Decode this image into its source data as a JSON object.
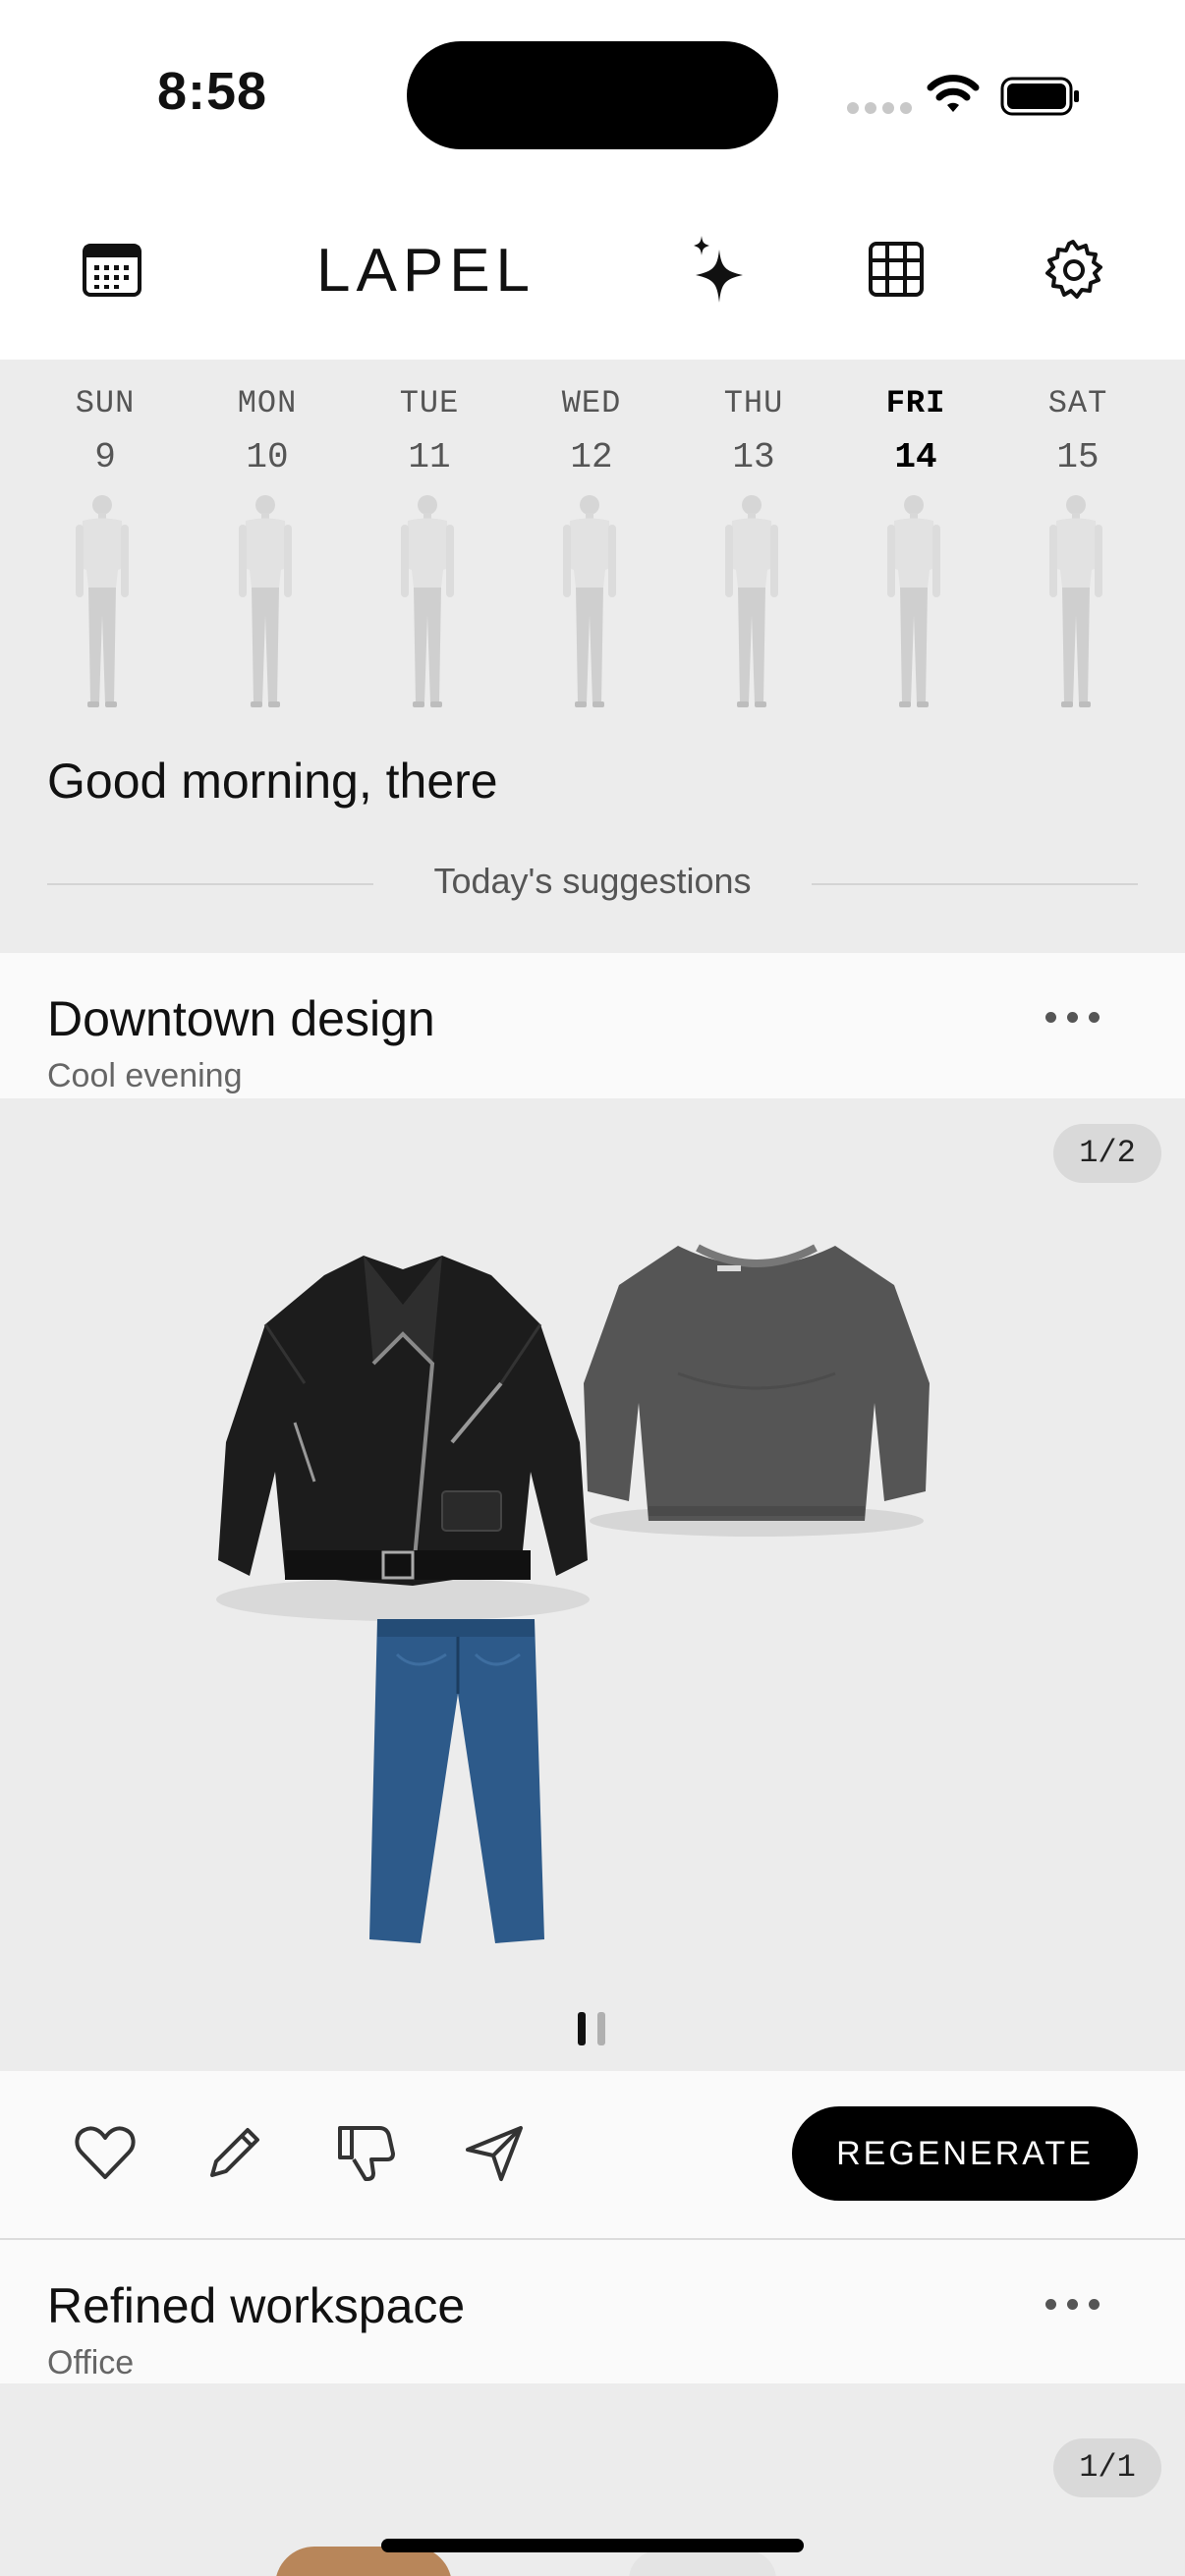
{
  "status_bar": {
    "time": "8:58"
  },
  "header": {
    "brand": "LAPEL"
  },
  "week": {
    "days": [
      {
        "name": "SUN",
        "date": "9"
      },
      {
        "name": "MON",
        "date": "10"
      },
      {
        "name": "TUE",
        "date": "11"
      },
      {
        "name": "WED",
        "date": "12"
      },
      {
        "name": "THU",
        "date": "13"
      },
      {
        "name": "FRI",
        "date": "14"
      },
      {
        "name": "SAT",
        "date": "15"
      }
    ],
    "selected_day": "FRI"
  },
  "greeting": "Good morning, there",
  "suggestions_label": "Today's suggestions",
  "cards": [
    {
      "title": "Downtown design",
      "subtitle": "Cool evening",
      "pager": "1/2",
      "items": [
        "leather-jacket",
        "grey-sweater",
        "blue-jeans"
      ]
    },
    {
      "title": "Refined workspace",
      "subtitle": "Office",
      "pager": "1/1"
    }
  ],
  "actions": {
    "regenerate_label": "REGENERATE"
  },
  "colors": {
    "accent": "#000000",
    "panel": "#ececec",
    "card_header": "#fafafa"
  }
}
